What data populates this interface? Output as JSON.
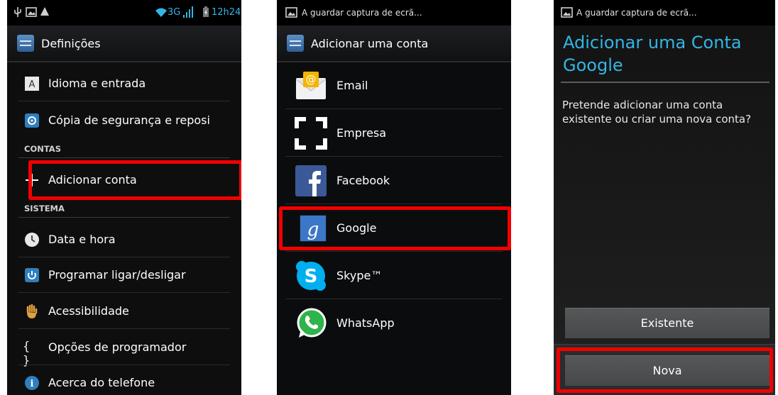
{
  "screen1": {
    "status_network": "3G",
    "status_time": "12h24",
    "title": "Definições",
    "items_top": [
      {
        "label": "Idioma e entrada",
        "icon": "language-icon"
      },
      {
        "label": "Cópia de segurança e reposi",
        "icon": "backup-icon"
      }
    ],
    "section_accounts": "CONTAS",
    "add_account": "Adicionar conta",
    "section_system": "SISTEMA",
    "items_system": [
      {
        "label": "Data e hora",
        "icon": "clock-icon"
      },
      {
        "label": "Programar ligar/desligar",
        "icon": "power-schedule-icon"
      },
      {
        "label": "Acessibilidade",
        "icon": "hand-icon"
      },
      {
        "label": "Opções de programador",
        "icon": "braces-icon"
      },
      {
        "label": "Acerca do telefone",
        "icon": "info-icon"
      }
    ]
  },
  "screen2": {
    "status_note": "A guardar captura de ecrã...",
    "title": "Adicionar uma conta",
    "accounts": [
      {
        "label": "Email",
        "icon": "email-icon"
      },
      {
        "label": "Empresa",
        "icon": "corporate-icon"
      },
      {
        "label": "Facebook",
        "icon": "facebook-icon"
      },
      {
        "label": "Google",
        "icon": "google-icon"
      },
      {
        "label": "Skype™",
        "icon": "skype-icon"
      },
      {
        "label": "WhatsApp",
        "icon": "whatsapp-icon"
      }
    ]
  },
  "screen3": {
    "status_note": "A guardar captura de ecrã...",
    "title": "Adicionar uma Conta Google",
    "question": "Pretende adicionar uma conta existente ou criar uma nova conta?",
    "existing_button": "Existente",
    "new_button": "Nova"
  },
  "colors": {
    "accent": "#33b5e5",
    "highlight": "#f20000"
  }
}
